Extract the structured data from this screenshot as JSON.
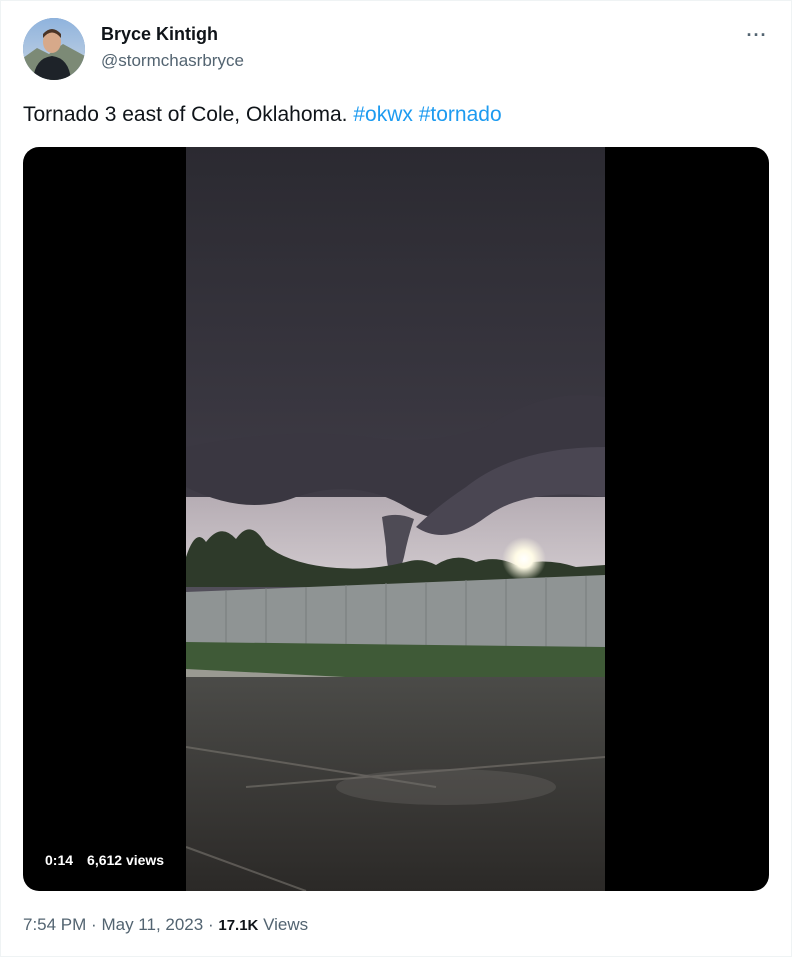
{
  "author": {
    "name": "Bryce Kintigh",
    "handle": "@stormchasrbryce"
  },
  "more_icon": "ellipsis-icon",
  "tweet": {
    "text": "Tornado 3 east of Cole, Oklahoma.",
    "hashtags": [
      "#okwx",
      "#tornado"
    ]
  },
  "media": {
    "duration": "0:14",
    "views": "6,612 views"
  },
  "meta": {
    "time": "7:54 PM",
    "date": "May 11, 2023",
    "separator": "·",
    "views_count": "17.1K",
    "views_label": "Views"
  },
  "colors": {
    "link": "#1d9bf0",
    "secondary_text": "#536471"
  }
}
